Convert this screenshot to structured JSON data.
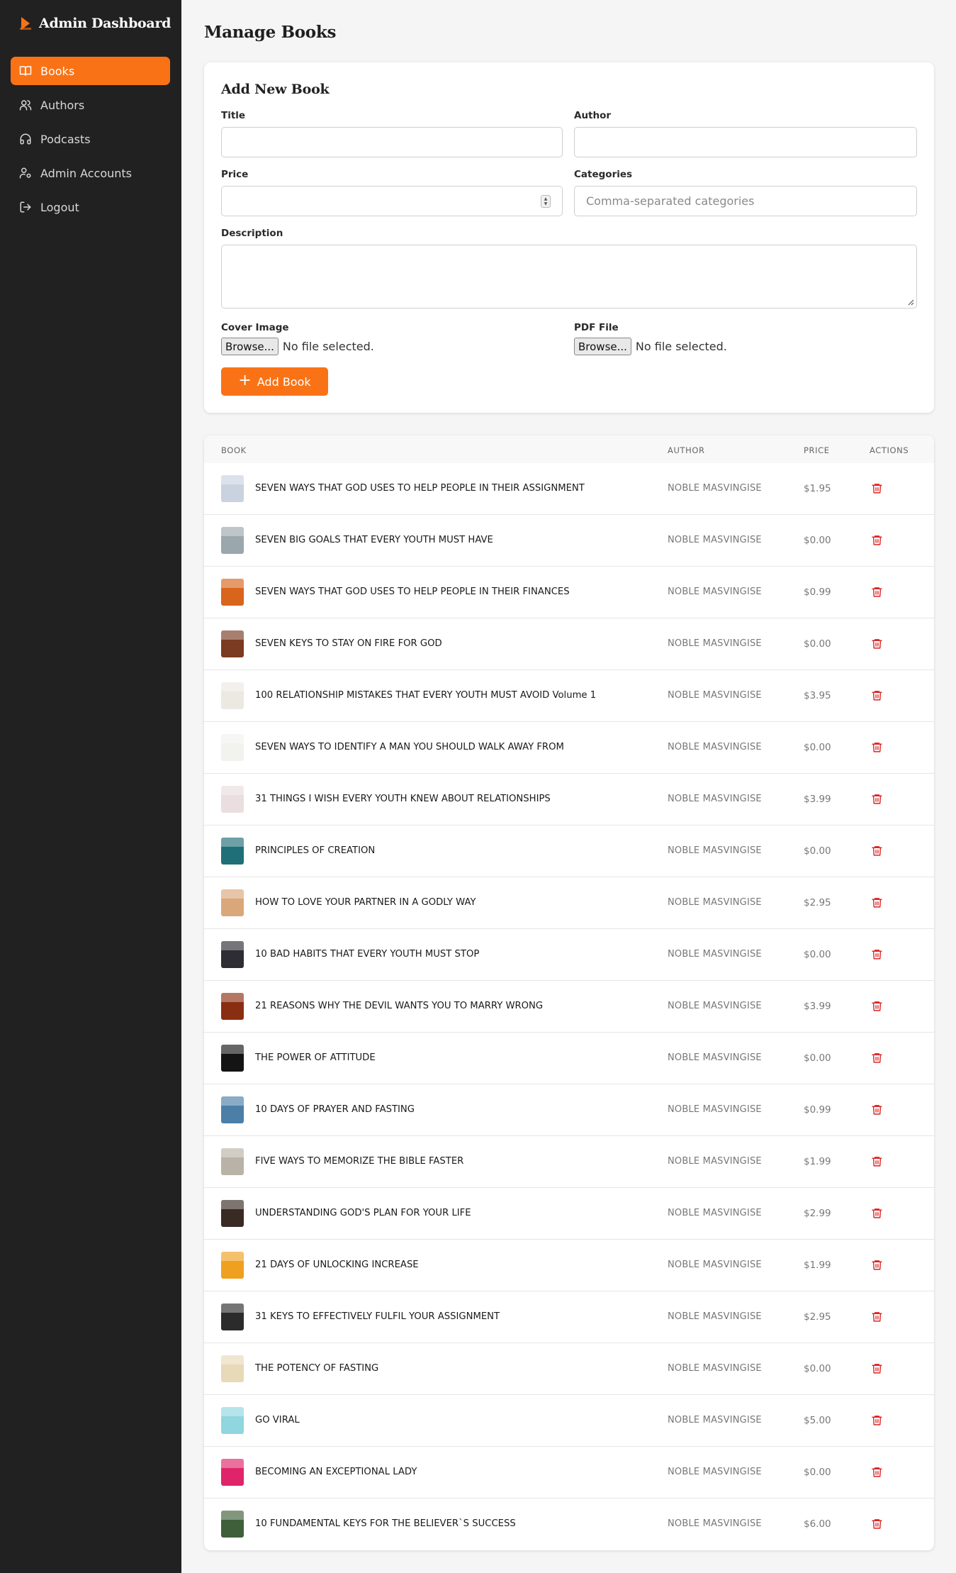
{
  "app": {
    "title": "Admin Dashboard"
  },
  "sidebar": {
    "items": [
      {
        "label": "Books",
        "icon": "book-open-icon",
        "active": true
      },
      {
        "label": "Authors",
        "icon": "users-icon",
        "active": false
      },
      {
        "label": "Podcasts",
        "icon": "headphones-icon",
        "active": false
      },
      {
        "label": "Admin Accounts",
        "icon": "user-cog-icon",
        "active": false
      },
      {
        "label": "Logout",
        "icon": "logout-icon",
        "active": false
      }
    ]
  },
  "page": {
    "title": "Manage Books"
  },
  "form": {
    "title": "Add New Book",
    "title_label": "Title",
    "title_value": "",
    "author_label": "Author",
    "author_value": "",
    "price_label": "Price",
    "price_value": "",
    "categories_label": "Categories",
    "categories_placeholder": "Comma-separated categories",
    "description_label": "Description",
    "description_value": "",
    "cover_label": "Cover Image",
    "pdf_label": "PDF File",
    "browse_label": "Browse...",
    "no_file_text": "No file selected.",
    "submit_label": "Add Book"
  },
  "table": {
    "headers": {
      "book": "BOOK",
      "author": "AUTHOR",
      "price": "PRICE",
      "actions": "ACTIONS"
    },
    "rows": [
      {
        "title": "SEVEN WAYS THAT GOD USES TO HELP PEOPLE IN THEIR ASSIGNMENT",
        "author": "NOBLE MASVINGISE",
        "price": "$1.95",
        "cover": "#c9d3e0"
      },
      {
        "title": "SEVEN BIG GOALS THAT EVERY YOUTH MUST HAVE",
        "author": "NOBLE MASVINGISE",
        "price": "$0.00",
        "cover": "#9aa7ad"
      },
      {
        "title": "SEVEN WAYS THAT GOD USES TO HELP PEOPLE IN THEIR FINANCES",
        "author": "NOBLE MASVINGISE",
        "price": "$0.99",
        "cover": "#d9641c"
      },
      {
        "title": "SEVEN KEYS TO STAY ON FIRE FOR GOD",
        "author": "NOBLE MASVINGISE",
        "price": "$0.00",
        "cover": "#7a3b22"
      },
      {
        "title": "100 RELATIONSHIP MISTAKES THAT EVERY YOUTH MUST AVOID Volume 1",
        "author": "NOBLE MASVINGISE",
        "price": "$3.95",
        "cover": "#ece8e2"
      },
      {
        "title": "SEVEN WAYS TO IDENTIFY A MAN YOU SHOULD WALK AWAY FROM",
        "author": "NOBLE MASVINGISE",
        "price": "$0.00",
        "cover": "#f2f2ee"
      },
      {
        "title": "31 THINGS I WISH EVERY YOUTH KNEW ABOUT RELATIONSHIPS",
        "author": "NOBLE MASVINGISE",
        "price": "$3.99",
        "cover": "#eadede"
      },
      {
        "title": "PRINCIPLES OF CREATION",
        "author": "NOBLE MASVINGISE",
        "price": "$0.00",
        "cover": "#1f6f78"
      },
      {
        "title": "HOW TO LOVE YOUR PARTNER IN A GODLY WAY",
        "author": "NOBLE MASVINGISE",
        "price": "$2.95",
        "cover": "#d9a77a"
      },
      {
        "title": "10 BAD HABITS THAT EVERY YOUTH MUST STOP",
        "author": "NOBLE MASVINGISE",
        "price": "$0.00",
        "cover": "#2d2d33"
      },
      {
        "title": "21 REASONS WHY THE DEVIL WANTS YOU TO MARRY WRONG",
        "author": "NOBLE MASVINGISE",
        "price": "$3.99",
        "cover": "#8a2e12"
      },
      {
        "title": "THE POWER OF ATTITUDE",
        "author": "NOBLE MASVINGISE",
        "price": "$0.00",
        "cover": "#141414"
      },
      {
        "title": "10 DAYS OF PRAYER AND FASTING",
        "author": "NOBLE MASVINGISE",
        "price": "$0.99",
        "cover": "#4b7fa8"
      },
      {
        "title": "FIVE WAYS TO MEMORIZE THE BIBLE FASTER",
        "author": "NOBLE MASVINGISE",
        "price": "$1.99",
        "cover": "#b9b2a6"
      },
      {
        "title": "UNDERSTANDING GOD'S PLAN FOR YOUR LIFE",
        "author": "NOBLE MASVINGISE",
        "price": "$2.99",
        "cover": "#3a2a24"
      },
      {
        "title": "21 DAYS OF UNLOCKING INCREASE",
        "author": "NOBLE MASVINGISE",
        "price": "$1.99",
        "cover": "#f0a020"
      },
      {
        "title": "31 KEYS TO EFFECTIVELY FULFIL YOUR ASSIGNMENT",
        "author": "NOBLE MASVINGISE",
        "price": "$2.95",
        "cover": "#2b2b2b"
      },
      {
        "title": "THE POTENCY OF FASTING",
        "author": "NOBLE MASVINGISE",
        "price": "$0.00",
        "cover": "#e8d9b8"
      },
      {
        "title": "GO VIRAL",
        "author": "NOBLE MASVINGISE",
        "price": "$5.00",
        "cover": "#8fd6df"
      },
      {
        "title": "BECOMING AN EXCEPTIONAL LADY",
        "author": "NOBLE MASVINGISE",
        "price": "$0.00",
        "cover": "#e0246a"
      },
      {
        "title": "10 FUNDAMENTAL KEYS FOR THE BELIEVER`S SUCCESS",
        "author": "NOBLE MASVINGISE",
        "price": "$6.00",
        "cover": "#3f5f3a"
      }
    ]
  },
  "colors": {
    "accent": "#f97316",
    "sidebar": "#212121",
    "danger": "#dc2626"
  }
}
